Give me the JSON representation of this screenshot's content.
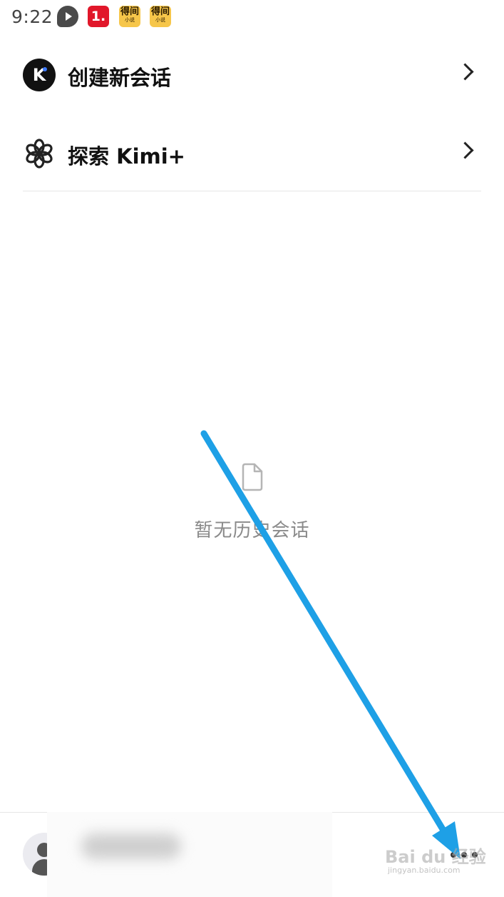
{
  "status_bar": {
    "time": "9:22",
    "notif_red_label": "1.",
    "notif_yellow_label": "得间",
    "notif_yellow_sub": "小说"
  },
  "menu": {
    "new_chat_label": "创建新会话",
    "explore_label": "探索 Kimi+",
    "logo_letter": "K"
  },
  "empty_state": {
    "text": "暂无历史会话"
  },
  "colors": {
    "accent_arrow": "#1ea0e6",
    "text_primary": "#111111",
    "text_secondary": "#8a8a8a",
    "divider": "#e6e6e6"
  },
  "watermark": {
    "brand": "Bai du 经验",
    "url": "jingyan.baidu.com"
  },
  "icons": {
    "more": "more-horizontal-icon",
    "avatar": "user-avatar-icon",
    "explore": "flower-icon",
    "empty": "document-icon"
  }
}
